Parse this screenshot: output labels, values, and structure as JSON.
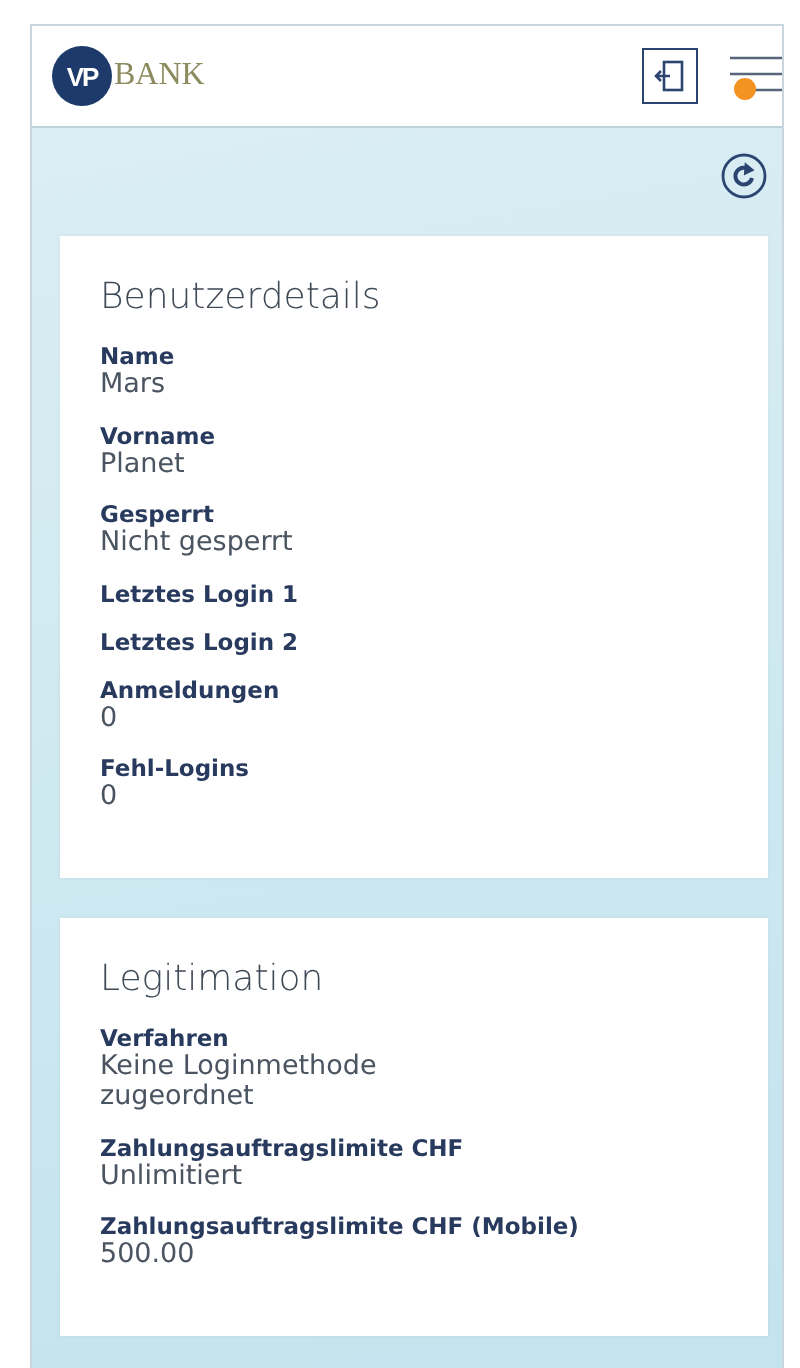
{
  "header": {
    "logo_mark": "VP",
    "logo_text": "BANK",
    "menu_notification": true
  },
  "cards": [
    {
      "title": "Benutzerdetails",
      "fields": [
        {
          "label": "Name",
          "value": "Mars"
        },
        {
          "label": "Vorname",
          "value": "Planet"
        },
        {
          "label": "Gesperrt",
          "value": "Nicht gesperrt"
        },
        {
          "label": "Letztes Login 1"
        },
        {
          "label": "Letztes Login 2"
        },
        {
          "label": "Anmeldungen",
          "value": "0"
        },
        {
          "label": "Fehl-Logins",
          "value": "0"
        }
      ]
    },
    {
      "title": "Legitimation",
      "fields": [
        {
          "label": "Verfahren",
          "value": "Keine Loginmethode zugeordnet"
        },
        {
          "label": "Zahlungsauftragslimite CHF",
          "value": "Unlimitiert"
        },
        {
          "label": "Zahlungsauftragslimite CHF (Mobile)",
          "value": "500.00"
        }
      ]
    }
  ]
}
